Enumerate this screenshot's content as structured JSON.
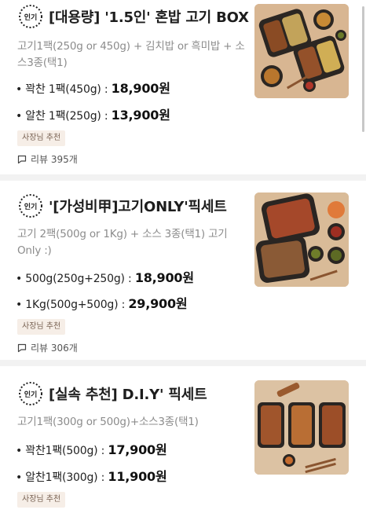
{
  "menu_items": [
    {
      "badge": "인기",
      "title": "[대용량] '1.5인' 혼밥 고기 BOX",
      "description": "고기1팩(250g or 450g) + 김치밥 or 흑미밥 + 소스3종(택1)",
      "options": [
        {
          "label": "• 꽉찬 1팩(450g) : ",
          "price": "18,900원"
        },
        {
          "label": "• 알찬 1팩(250g) : ",
          "price": "13,900원"
        }
      ],
      "tag": "사장님 추천",
      "review_text": "리뷰 395개"
    },
    {
      "badge": "인기",
      "title": "'[가성비甲]고기ONLY'픽세트",
      "description": "고기 2팩(500g or 1Kg) + 소스 3종(택1) 고기 Only :)",
      "options": [
        {
          "label": "• 500g(250g+250g) : ",
          "price": "18,900원"
        },
        {
          "label": "• 1Kg(500g+500g) : ",
          "price": "29,900원"
        }
      ],
      "tag": "사장님 추천",
      "review_text": "리뷰 306개"
    },
    {
      "badge": "인기",
      "title": "[실속 추천] D.I.Y' 픽세트",
      "description": "고기1팩(300g or 500g)+소스3종(택1)",
      "options": [
        {
          "label": "• 꽉찬1팩(500g) : ",
          "price": "17,900원"
        },
        {
          "label": "• 알찬1팩(300g) : ",
          "price": "11,900원"
        }
      ],
      "tag": "사장님 추천"
    }
  ],
  "colors": {
    "tag_bg": "#f6eee7",
    "tag_text": "#7a6455",
    "divider": "#f2f2f2",
    "description": "#8c8c8c"
  },
  "icons": [
    "popular-badge-icon",
    "comment-icon"
  ]
}
